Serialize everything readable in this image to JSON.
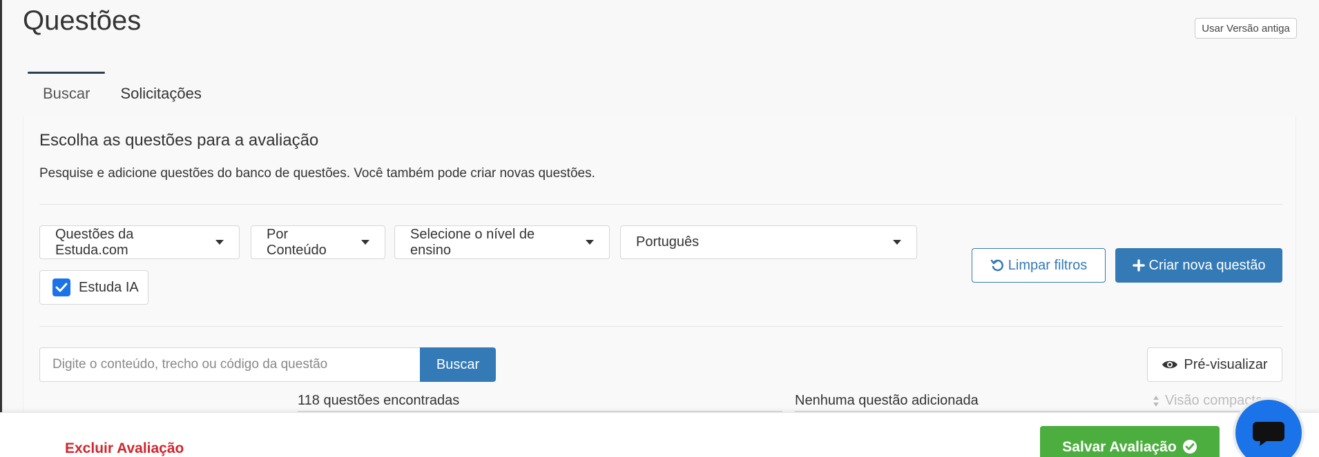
{
  "page": {
    "title": "Questões",
    "old_version_label": "Usar Versão antiga"
  },
  "tabs": [
    {
      "label": "Buscar",
      "active": true
    },
    {
      "label": "Solicitações",
      "active": false
    }
  ],
  "panel": {
    "title": "Escolha as questões para a avaliação",
    "subtitle": "Pesquise e adicione questões do banco de questões. Você também pode criar novas questões."
  },
  "filters": {
    "source": "Questões da Estuda.com",
    "mode": "Por Conteúdo",
    "level": "Selecione o nível de ensino",
    "subject": "Português",
    "ai_checkbox": {
      "label": "Estuda IA",
      "checked": true
    },
    "clear_label": "Limpar filtros",
    "create_label": "Criar nova questão"
  },
  "search": {
    "placeholder": "Digite o conteúdo, trecho ou código da questão",
    "button_label": "Buscar",
    "preview_label": "Pré-visualizar"
  },
  "results": {
    "found_text": "118 questões encontradas",
    "added_text": "Nenhuma questão adicionada",
    "compact_label": "Visão compacta"
  },
  "footer": {
    "delete_label": "Excluir Avaliação",
    "save_label": "Salvar Avaliação"
  },
  "colors": {
    "primary": "#337ab7",
    "success": "#4cae3e",
    "danger": "#d0262d",
    "checkbox": "#1a73e8"
  }
}
